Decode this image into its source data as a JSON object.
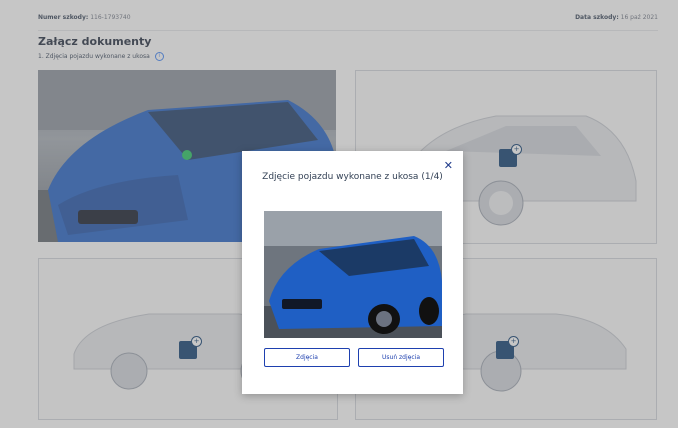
{
  "header": {
    "claim_label": "Numer szkody:",
    "claim_number": "116-1793740",
    "date_label": "Data szkody:",
    "date_value": "16 paź 2021"
  },
  "section": {
    "title": "Załącz dokumenty",
    "subtitle": "1. Zdjęcia pojazdu wykonane z ukosa",
    "info_icon": "info-icon"
  },
  "modal": {
    "title": "Zdjęcie pojazdu wykonane z ukosa (1/4)",
    "close_glyph": "✕",
    "retake_label": "Zdjęcia",
    "delete_label": "Usuń zdjęcia"
  },
  "colors": {
    "accent": "#1e40af",
    "badge": "#0b3b6f",
    "ok": "#22c55e",
    "car_blue": "#1f5fc4"
  }
}
